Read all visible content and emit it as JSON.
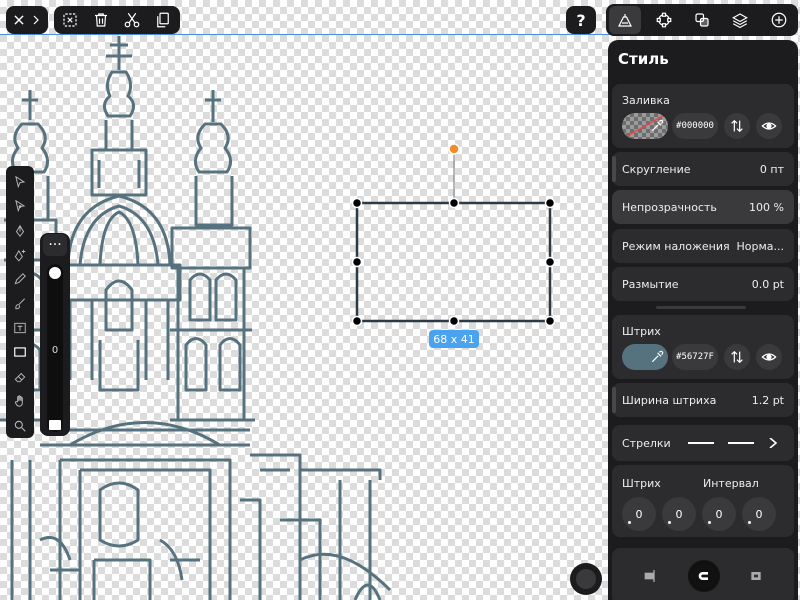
{
  "canvas": {
    "selection_size": "68 x 41",
    "stroke_color": "#56727F",
    "selection_color": "#2b3a44",
    "accent_color": "#4aa3f0"
  },
  "top_toolbar": {
    "icons": [
      "close-icon",
      "chevron-right-icon",
      "group-select-icon",
      "trash-icon",
      "scissors-icon",
      "copy-icon"
    ],
    "help_label": "?"
  },
  "tabs": [
    "style-tab",
    "node-tab",
    "arrange-tab",
    "layers-tab",
    "add-tab"
  ],
  "tools": [
    "select-icon",
    "direct-select-icon",
    "pen-icon",
    "pen-add-icon",
    "pencil-icon",
    "brush-icon",
    "text-icon",
    "rectangle-icon",
    "eraser-icon",
    "hand-icon",
    "zoom-icon"
  ],
  "slider": {
    "menu_label": "···",
    "value": "0"
  },
  "style_panel": {
    "title": "Стиль",
    "fill": {
      "label": "Заливка",
      "hex": "#000000"
    },
    "rounding": {
      "label": "Скругление",
      "value": "0 пт"
    },
    "opacity": {
      "label": "Непрозрачность",
      "value": "100 %"
    },
    "blend": {
      "label": "Режим наложения",
      "value": "Норма..."
    },
    "blur": {
      "label": "Размытие",
      "value": "0.0 pt"
    },
    "stroke": {
      "label": "Штрих",
      "hex": "#56727F",
      "color": "#56727F"
    },
    "stroke_width": {
      "label": "Ширина штриха",
      "value": "1.2 pt"
    },
    "arrows": {
      "label": "Стрелки"
    },
    "dash": {
      "stroke_label": "Штрих",
      "interval_label": "Интервал",
      "values": [
        "0",
        "0",
        "0",
        "0"
      ]
    }
  }
}
